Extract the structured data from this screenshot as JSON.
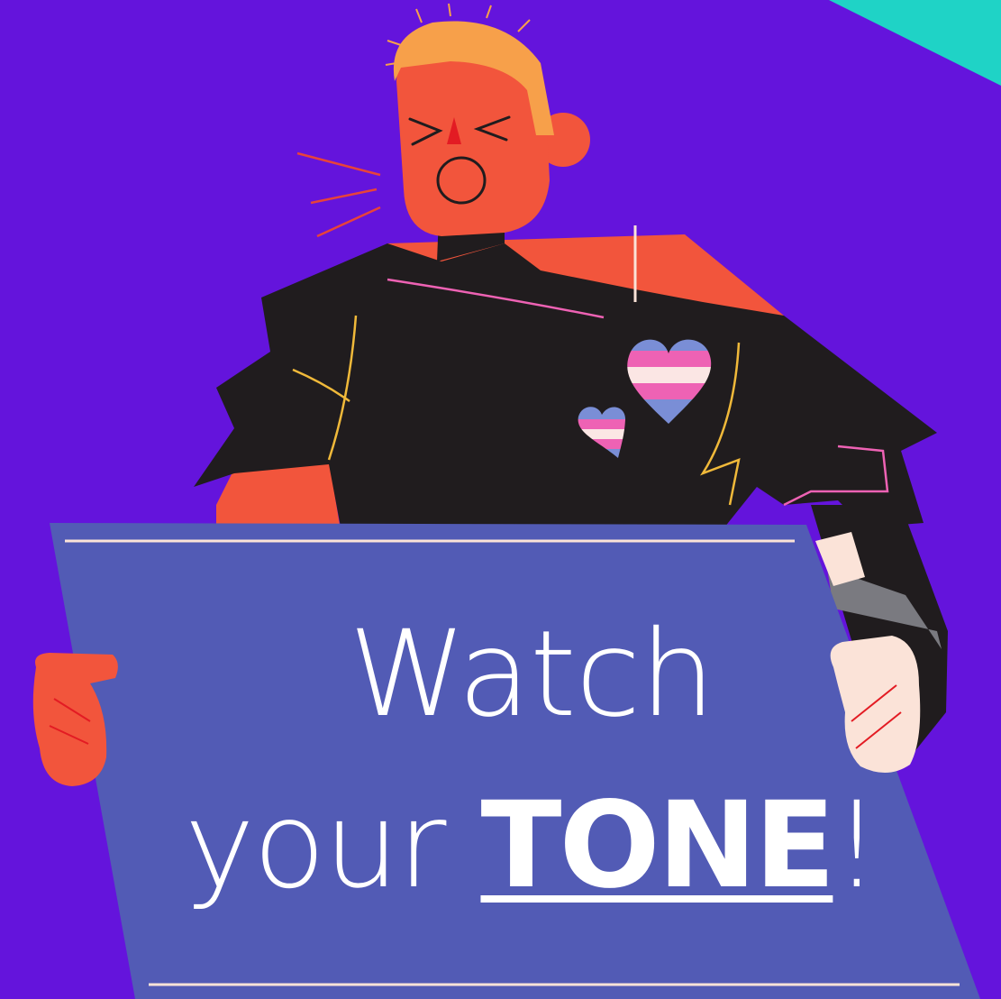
{
  "sign": {
    "line1": "Watch",
    "line2_prefix": "your",
    "line2_emphasis": "TONE",
    "line2_suffix": "!"
  },
  "colors": {
    "background": "#6414DC",
    "corner_accent": "#1FD3C6",
    "skin": "#F2553C",
    "hair": "#F7A04A",
    "shirt": "#201C1E",
    "sign_board": "#525BB5",
    "sign_text": "#FFFFFF",
    "glove": "#FBE3D8",
    "heart_blue": "#7A8ED6",
    "heart_pink": "#EE62B4",
    "heart_white": "#FBE6E4"
  },
  "icons": [
    "trans-flag-heart-icon",
    "trans-flag-heart-icon"
  ]
}
